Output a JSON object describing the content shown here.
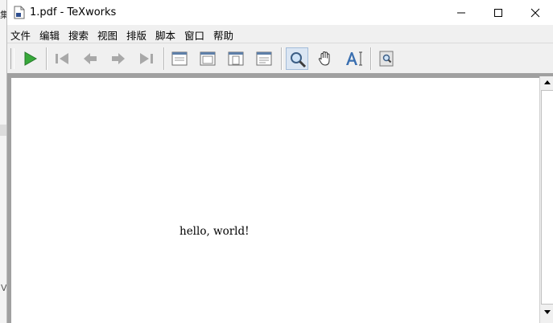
{
  "behind_window": {
    "char_top": "集",
    "char_bottom": "V"
  },
  "window": {
    "title": "1.pdf - TeXworks"
  },
  "menu": [
    {
      "label": "文件"
    },
    {
      "label": "编辑"
    },
    {
      "label": "搜索"
    },
    {
      "label": "视图"
    },
    {
      "label": "排版"
    },
    {
      "label": "脚本"
    },
    {
      "label": "窗口"
    },
    {
      "label": "帮助"
    }
  ],
  "toolbar": {
    "typeset_icon": "play-icon",
    "navigation_icons": [
      "first-page-icon",
      "previous-page-icon",
      "next-page-icon",
      "last-page-icon"
    ],
    "view_icons": [
      "actual-size-icon",
      "fit-width-icon",
      "fit-page-icon",
      "fit-window-icon"
    ],
    "tool_icons": [
      "magnify-icon",
      "hand-scroll-icon",
      "select-text-icon"
    ],
    "active_tool": "magnify-icon",
    "extra_icons": [
      "full-screen-icon"
    ]
  },
  "document": {
    "text": "hello, world!"
  },
  "colors": {
    "play_green": "#37a83a",
    "nav_gray": "#a8a8a8",
    "viewer_bg": "#a0a0a0",
    "active_tool_bg": "#dbe6f3",
    "text_tool_blue": "#3a6fb0"
  }
}
